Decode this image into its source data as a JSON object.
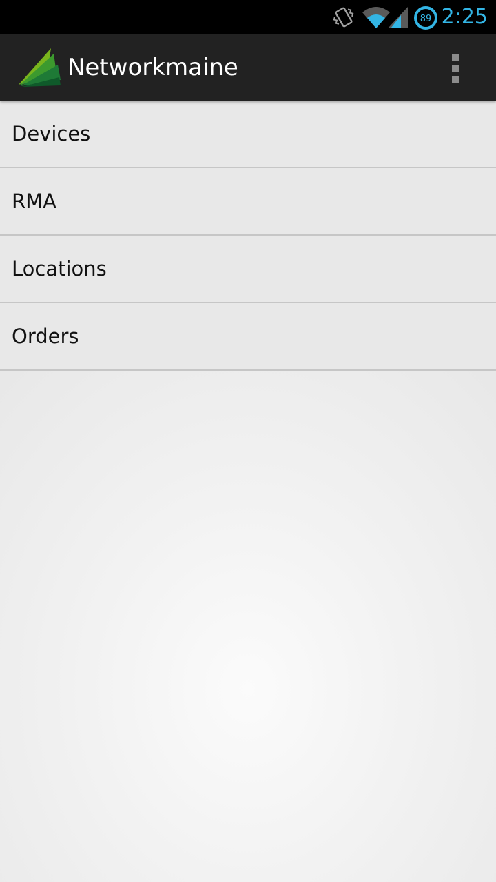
{
  "status_bar": {
    "time": "2:25",
    "battery_level": "89",
    "icons": [
      "vibrate-icon",
      "wifi-icon",
      "cell-signal-icon",
      "battery-icon"
    ],
    "accent_color": "#33b5e5"
  },
  "action_bar": {
    "title": "Networkmaine",
    "logo_icon": "networkmaine-logo",
    "overflow_icon": "overflow-menu-icon",
    "background_color": "#222222"
  },
  "menu": {
    "items": [
      {
        "label": "Devices"
      },
      {
        "label": "RMA"
      },
      {
        "label": "Locations"
      },
      {
        "label": "Orders"
      }
    ]
  }
}
